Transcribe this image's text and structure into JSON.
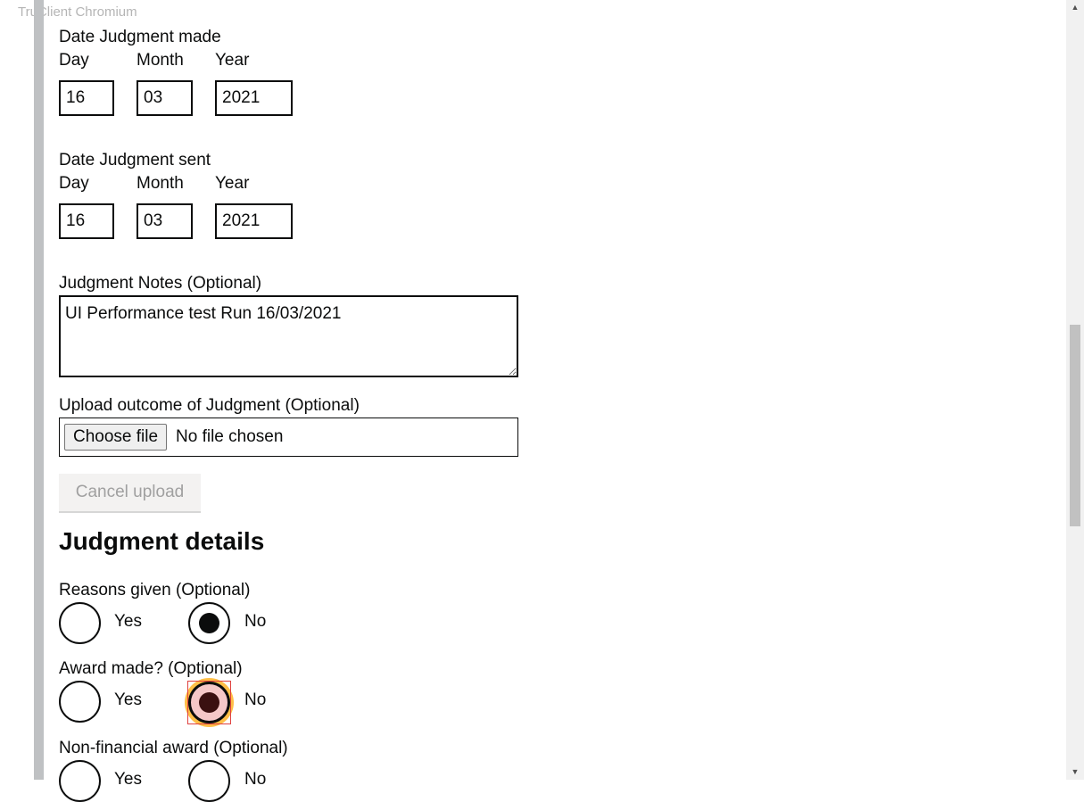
{
  "app": {
    "watermark": "TruClient Chromium"
  },
  "date_made": {
    "legend": "Date Judgment made",
    "day": {
      "label": "Day",
      "value": "16"
    },
    "month": {
      "label": "Month",
      "value": "03"
    },
    "year": {
      "label": "Year",
      "value": "2021"
    }
  },
  "date_sent": {
    "legend": "Date Judgment sent",
    "day": {
      "label": "Day",
      "value": "16"
    },
    "month": {
      "label": "Month",
      "value": "03"
    },
    "year": {
      "label": "Year",
      "value": "2021"
    }
  },
  "notes": {
    "label": "Judgment Notes (Optional)",
    "value": "UI Performance test Run 16/03/2021"
  },
  "upload": {
    "label": "Upload outcome of Judgment (Optional)",
    "button_label": "Choose file",
    "status": "No file chosen",
    "cancel_label": "Cancel upload"
  },
  "details": {
    "heading": "Judgment details",
    "reasons": {
      "legend": "Reasons given (Optional)",
      "yes": "Yes",
      "no": "No",
      "selected": "No"
    },
    "award": {
      "legend": "Award made? (Optional)",
      "yes": "Yes",
      "no": "No",
      "selected": "No"
    },
    "nonfinancial": {
      "legend": "Non-financial award (Optional)",
      "yes": "Yes",
      "no": "No",
      "selected": ""
    }
  },
  "icons": {
    "scroll_up": "triangle-up",
    "scroll_down": "triangle-down"
  }
}
